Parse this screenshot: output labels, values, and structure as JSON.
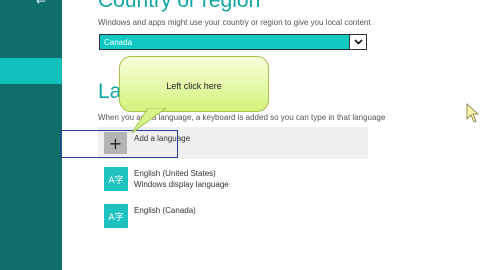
{
  "sidebar": {
    "back_glyph": "←"
  },
  "region": {
    "heading": "Country or region",
    "description": "Windows and apps might use your country or region to give you local content",
    "selected": "Canada"
  },
  "language": {
    "heading": "Language",
    "description": "When you add a language, a keyboard is added so you can type in that language",
    "add_label": "Add a language",
    "items": [
      {
        "name": "English (United States)",
        "sub": "Windows display language",
        "icon_text": "A字"
      },
      {
        "name": "English (Canada)",
        "sub": "",
        "icon_text": "A字"
      }
    ]
  },
  "callout": {
    "text": "Left click here"
  },
  "colors": {
    "sidebar": "#0e6e6a",
    "accent": "#0ec9c1",
    "heading": "#0ea7a4"
  }
}
